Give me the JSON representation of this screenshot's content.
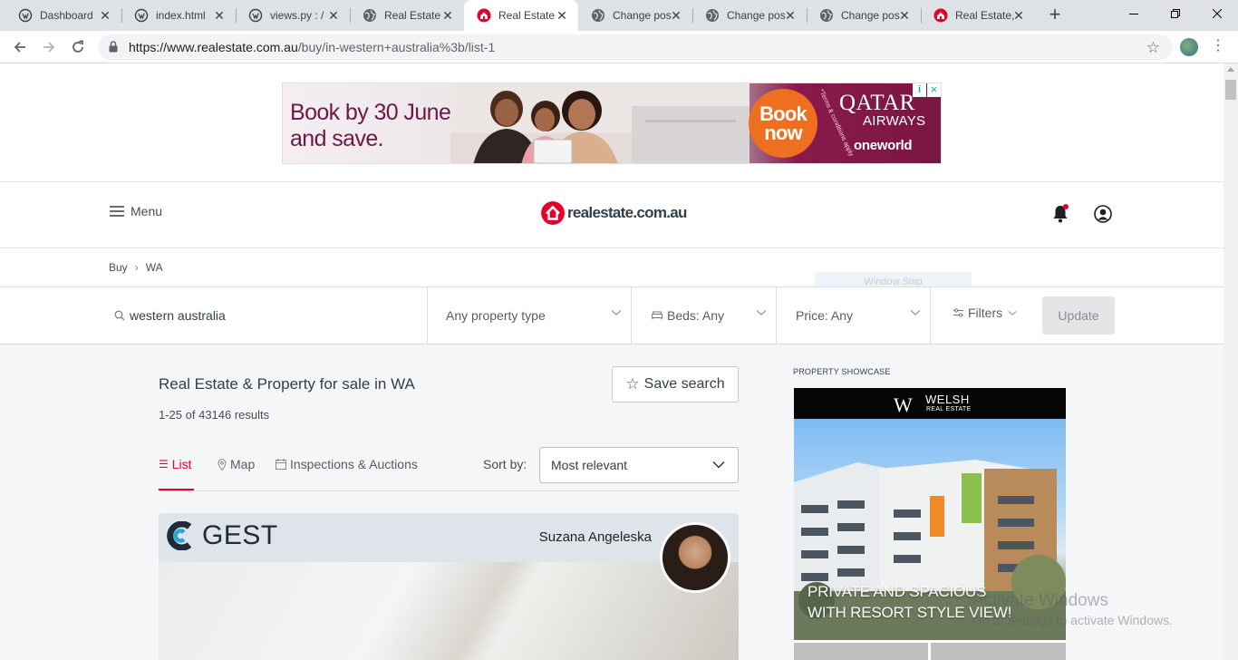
{
  "browser": {
    "tabs": [
      {
        "title": "Dashboard",
        "icon": "wp-icon",
        "active": false
      },
      {
        "title": "index.html",
        "icon": "wp-icon",
        "active": false
      },
      {
        "title": "views.py : /",
        "icon": "wp-icon",
        "active": false
      },
      {
        "title": "Real Estate",
        "icon": "globe-icon",
        "active": false
      },
      {
        "title": "Real Estate",
        "icon": "rea-icon",
        "active": true
      },
      {
        "title": "Change pos",
        "icon": "globe-icon",
        "active": false
      },
      {
        "title": "Change pos",
        "icon": "globe-icon",
        "active": false
      },
      {
        "title": "Change pos",
        "icon": "globe-icon",
        "active": false
      },
      {
        "title": "Real Estate,",
        "icon": "rea-icon",
        "active": false
      }
    ],
    "new_tab": "+",
    "url_host": "https://www.realestate.com.au",
    "url_path": "/buy/in-western+australia%3b/list-1"
  },
  "ad": {
    "headline": "Book by 30 June and save.",
    "cta": "Book now",
    "terms": "*Terms & conditions apply",
    "brand_line1": "QATAR",
    "brand_line2": "AIRWAYS",
    "alliance": "oneworld",
    "colors": {
      "brand": "#6b1a45",
      "cta": "#ee6f1f"
    }
  },
  "header": {
    "menu_label": "Menu",
    "logo_text": "realestate.com.au",
    "brand_color": "#e4002b"
  },
  "breadcrumb": {
    "items": [
      "Buy",
      "WA"
    ]
  },
  "overlay": {
    "window_snip": "Window Snip"
  },
  "search": {
    "location": "western australia",
    "property_type": "Any property type",
    "beds": "Beds: Any",
    "price": "Price: Any",
    "filters": "Filters",
    "update": "Update"
  },
  "results": {
    "title": "Real Estate & Property for sale in WA",
    "count": "1-25 of 43146 results",
    "save_search": "Save search",
    "view_tabs": [
      {
        "label": "List",
        "icon": "list-icon",
        "active": true
      },
      {
        "label": "Map",
        "icon": "map-pin-icon",
        "active": false
      },
      {
        "label": "Inspections & Auctions",
        "icon": "calendar-icon",
        "active": false
      }
    ],
    "sort_label": "Sort by:",
    "sort_value": "Most relevant"
  },
  "listing": {
    "agency": "GEST",
    "agent_name": "Suzana Angeleska"
  },
  "showcase": {
    "label": "PROPERTY SHOWCASE",
    "brand_name": "WELSH",
    "brand_sub": "REAL ESTATE",
    "brand_mark": "W",
    "headline_line1": "PRIVATE AND SPACIOUS",
    "headline_line2": "WITH RESORT STYLE VIEW!"
  },
  "watermark": {
    "line1": "Activate Windows",
    "line2": "Go to Settings to activate Windows."
  }
}
